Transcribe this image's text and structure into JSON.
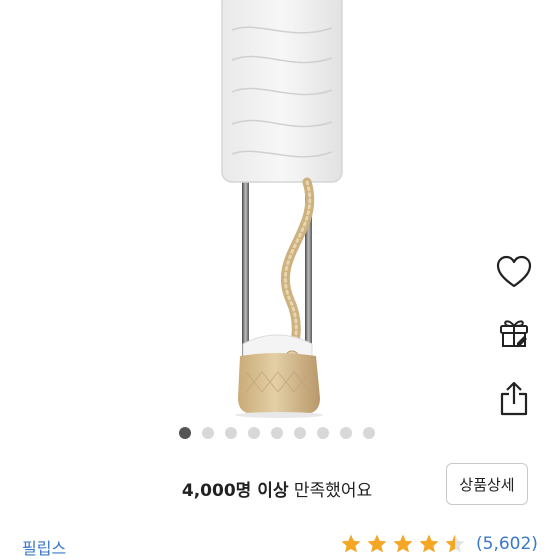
{
  "product": {
    "image_alt": "garment steamer",
    "gallery": {
      "total": 9,
      "active_index": 0
    }
  },
  "actions": {
    "wishlist_icon": "heart-icon",
    "gift_icon": "gift-icon",
    "share_icon": "share-icon"
  },
  "satisfaction": {
    "count_text": "4,000명 이상",
    "rest_text": " 만족했어요"
  },
  "detail_button": {
    "label": "상품상세"
  },
  "brand": {
    "name": "필립스"
  },
  "rating": {
    "stars": 4.5,
    "max": 5,
    "review_count": "(5,602)",
    "star_color": "#f5a623"
  },
  "colors": {
    "link": "#3a78c9",
    "gold_base": "#d3b98a",
    "active_dot": "#555555"
  }
}
